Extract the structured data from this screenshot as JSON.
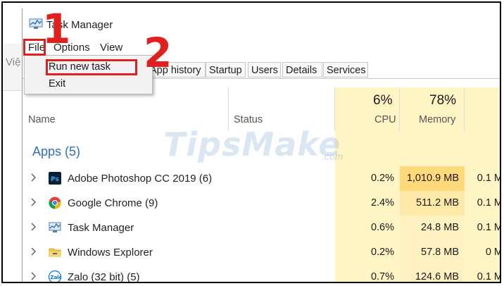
{
  "window": {
    "title": "Task Manager"
  },
  "background_window_text": "Việ",
  "menu": {
    "file": "File",
    "options": "Options",
    "view": "View"
  },
  "file_menu": {
    "run_new_task": "Run new task",
    "exit": "Exit"
  },
  "tabs": [
    "App history",
    "Startup",
    "Users",
    "Details",
    "Services"
  ],
  "columns": {
    "name": "Name",
    "status": "Status",
    "cpu_pct": "6%",
    "cpu": "CPU",
    "memory_pct": "78%",
    "memory": "Memory"
  },
  "group": {
    "title": "Apps (5)"
  },
  "rows": [
    {
      "name": "Adobe Photoshop CC 2019 (6)",
      "cpu": "0.2%",
      "memory": "1,010.9 MB",
      "disk": "0.1 M",
      "icon": "photoshop-icon"
    },
    {
      "name": "Google Chrome (9)",
      "cpu": "2.4%",
      "memory": "511.2 MB",
      "disk": "0.1 M",
      "icon": "chrome-icon"
    },
    {
      "name": "Task Manager",
      "cpu": "0.6%",
      "memory": "24.8 MB",
      "disk": "0.1 M",
      "icon": "task-manager-icon"
    },
    {
      "name": "Windows Explorer",
      "cpu": "0.2%",
      "memory": "57.8 MB",
      "disk": "0 M",
      "icon": "folder-icon"
    },
    {
      "name": "Zalo (32 bit) (5)",
      "cpu": "0.7%",
      "memory": "124.6 MB",
      "disk": "0.1 M",
      "icon": "zalo-icon"
    }
  ],
  "annotations": {
    "step1": "1",
    "step2": "2"
  },
  "watermark": {
    "text": "TipsMake",
    "suffix": ".com"
  },
  "colors": {
    "accent": "#2f6fc4",
    "highlight": "#e0201e",
    "heat_low": "#fff4c4",
    "heat_high": "#ffd97a"
  }
}
